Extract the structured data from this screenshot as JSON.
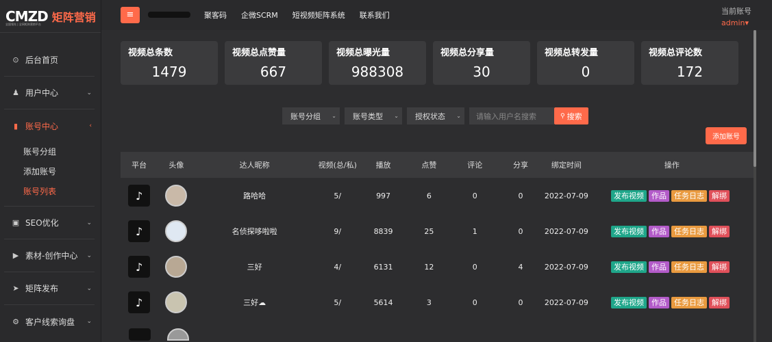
{
  "brand": {
    "mark": "CMZD",
    "name": "矩阵营销",
    "sub": "全国领先 | 全网矩阵营销平台"
  },
  "sidebar": {
    "items": [
      {
        "icon": "home-icon",
        "glyph": "⊙",
        "label": "后台首页"
      },
      {
        "icon": "user-icon",
        "glyph": "♟",
        "label": "用户中心",
        "chevron": "⌄"
      },
      {
        "icon": "bar-chart-icon",
        "glyph": "▮",
        "label": "账号中心",
        "chevron": "‹"
      },
      {
        "icon": "seo-icon",
        "glyph": "▣",
        "label": "SEO优化",
        "chevron": "⌄"
      },
      {
        "icon": "video-icon",
        "glyph": "▶",
        "label": "素材-创作中心",
        "chevron": "⌄"
      },
      {
        "icon": "send-icon",
        "glyph": "➤",
        "label": "矩阵发布",
        "chevron": "⌄"
      },
      {
        "icon": "gear-icon",
        "glyph": "⚙",
        "label": "客户线索询盘",
        "chevron": "⌄"
      }
    ],
    "sub_items": [
      "账号分组",
      "添加账号",
      "账号列表"
    ]
  },
  "topbar": {
    "menu_glyph": "≡",
    "nav": [
      "聚客码",
      "企微SCRM",
      "短视频矩阵系统",
      "联系我们"
    ],
    "account_label": "当前账号",
    "account_user": "admin▾"
  },
  "stats": [
    {
      "title": "视频总条数",
      "value": "1479"
    },
    {
      "title": "视频总点赞量",
      "value": "667"
    },
    {
      "title": "视频总曝光量",
      "value": "988308"
    },
    {
      "title": "视频总分享量",
      "value": "30"
    },
    {
      "title": "视频总转发量",
      "value": "0"
    },
    {
      "title": "视频总评论数",
      "value": "172"
    }
  ],
  "filters": {
    "group": "账号分组",
    "type": "账号类型",
    "auth": "授权状态",
    "search_placeholder": "请输入用户名搜索",
    "search_button": "搜索",
    "caret": "⌄",
    "search_glyph": "🔍"
  },
  "add_button": "添加账号",
  "table": {
    "headers": [
      "平台",
      "头像",
      "达人昵称",
      "视频(总/私)",
      "播放",
      "点赞",
      "评论",
      "分享",
      "绑定时间",
      "操作"
    ],
    "rows": [
      {
        "nickname": "路哈哈",
        "videos": "5/",
        "plays": "997",
        "likes": "6",
        "comments": "0",
        "shares": "0",
        "time": "2022-07-09"
      },
      {
        "nickname": "名侦探哆啦啦",
        "videos": "9/",
        "plays": "8839",
        "likes": "25",
        "comments": "1",
        "shares": "0",
        "time": "2022-07-09"
      },
      {
        "nickname": "三好",
        "videos": "4/",
        "plays": "6131",
        "likes": "12",
        "comments": "0",
        "shares": "4",
        "time": "2022-07-09"
      },
      {
        "nickname": "三好☁",
        "videos": "5/",
        "plays": "5614",
        "likes": "3",
        "comments": "0",
        "shares": "0",
        "time": "2022-07-09"
      }
    ],
    "ops": [
      "发布视频",
      "作品",
      "任务日志",
      "解绑"
    ],
    "platform_glyph": "♪"
  },
  "colors": {
    "accent": "#ff6a4a",
    "bg": "#2d2d2f",
    "card": "#3b3b3d",
    "green": "#1fa68a",
    "purple": "#b35bc9",
    "orange": "#e99a3f",
    "red": "#e0505a"
  }
}
